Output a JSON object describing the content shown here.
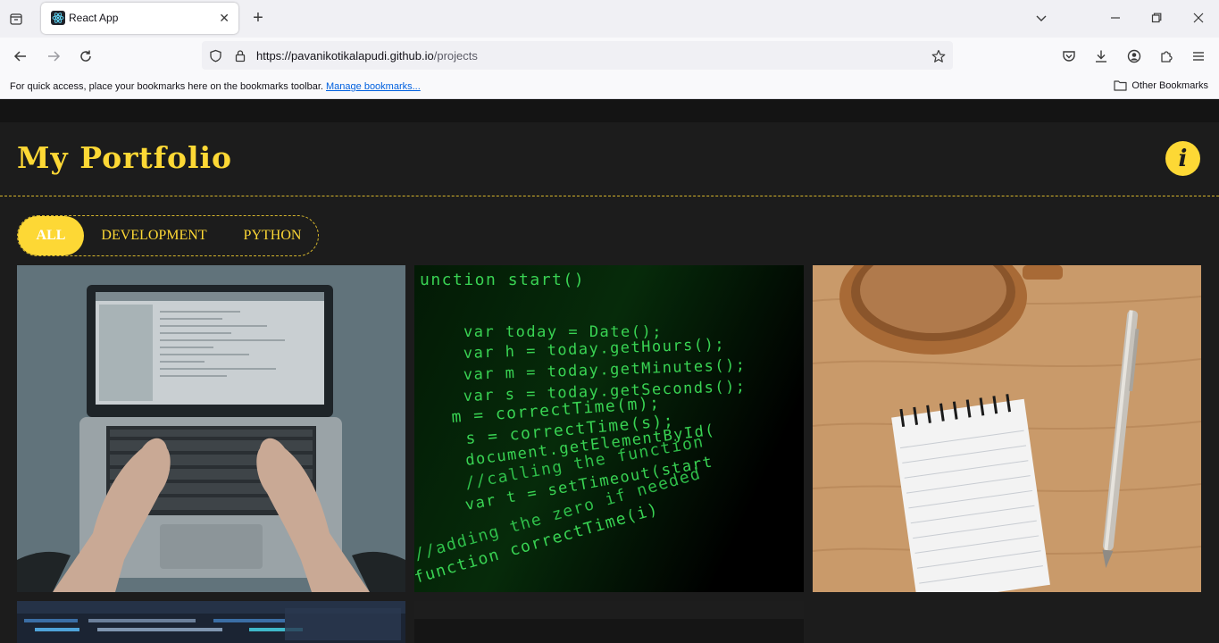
{
  "browser": {
    "tab_title": "React App",
    "url_host": "https://pavanikotikalapudi.github.io",
    "url_path": "/projects",
    "bookmarks_hint": "For quick access, place your bookmarks here on the bookmarks toolbar.",
    "manage_bookmarks": "Manage bookmarks...",
    "other_bookmarks": "Other Bookmarks"
  },
  "header": {
    "title": "My Portfolio",
    "info_glyph": "i"
  },
  "filters": [
    {
      "label": "ALL",
      "active": true
    },
    {
      "label": "DEVELOPMENT",
      "active": false
    },
    {
      "label": "PYTHON",
      "active": false
    }
  ],
  "projects": [
    {
      "image": "laptop-typing-photo"
    },
    {
      "image": "green-code-screen-photo"
    },
    {
      "image": "notepad-coffee-pen-photo"
    },
    {
      "image": "code-editor-screen-photo"
    },
    {
      "image": "dark-screen-photo"
    }
  ],
  "code_lines": [
    "unction start()",
    "var today =    Date();",
    "var h = today.getHours();",
    "var m = today.getMinutes();",
    "var s = today.getSeconds();",
    "m = correctTime(m);",
    "s = correctTime(s);",
    "document.getElementById(",
    "//calling the function",
    "var t = setTimeout(start",
    "//adding the zero if needed",
    "function correctTime(i)"
  ],
  "colors": {
    "accent": "#fdd835",
    "page_bg": "#1c1c1c",
    "code_green": "#39d353",
    "code_red": "#e8513a"
  }
}
